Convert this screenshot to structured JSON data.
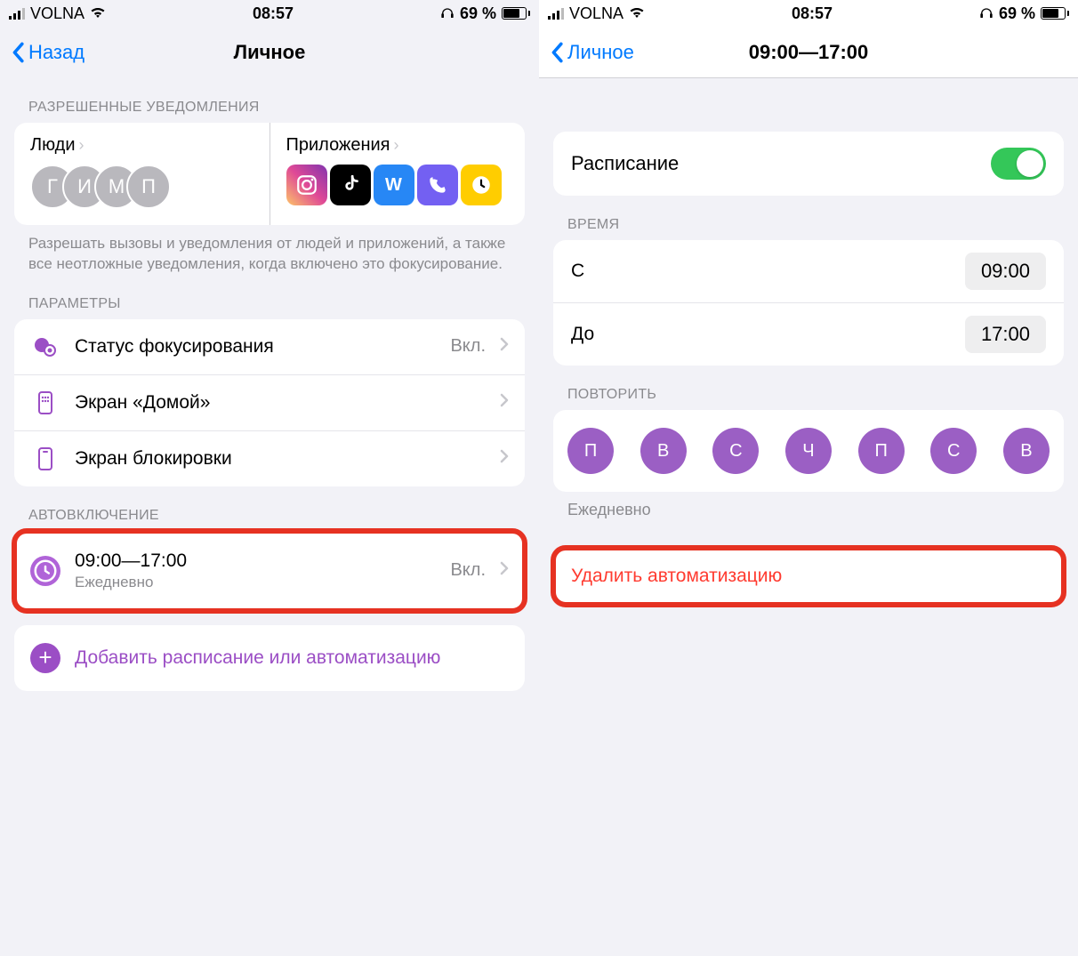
{
  "status": {
    "carrier": "VOLNA",
    "time": "08:57",
    "battery_pct": "69 %"
  },
  "left": {
    "back": "Назад",
    "title": "Личное",
    "sections": {
      "allowed": {
        "header": "РАЗРЕШЕННЫЕ УВЕДОМЛЕНИЯ",
        "people_label": "Люди",
        "apps_label": "Приложения",
        "people": [
          "Г",
          "И",
          "М",
          "П"
        ],
        "footer": "Разрешать вызовы и уведомления от людей и приложений, а также все неотложные уведомления, когда включено это фокусирование."
      },
      "params": {
        "header": "ПАРАМЕТРЫ",
        "focus_status": "Статус фокусирования",
        "focus_status_val": "Вкл.",
        "home_screen": "Экран «Домой»",
        "lock_screen": "Экран блокировки"
      },
      "auto": {
        "header": "АВТОВКЛЮЧЕНИЕ",
        "schedule_time": "09:00—17:00",
        "schedule_sub": "Ежедневно",
        "schedule_val": "Вкл.",
        "add": "Добавить расписание или автоматизацию"
      }
    }
  },
  "right": {
    "back": "Личное",
    "title": "09:00—17:00",
    "schedule_label": "Расписание",
    "time_header": "ВРЕМЯ",
    "from_label": "С",
    "from_val": "09:00",
    "to_label": "До",
    "to_val": "17:00",
    "repeat_header": "ПОВТОРИТЬ",
    "days": [
      "П",
      "В",
      "С",
      "Ч",
      "П",
      "С",
      "В"
    ],
    "repeat_caption": "Ежедневно",
    "delete": "Удалить автоматизацию"
  }
}
